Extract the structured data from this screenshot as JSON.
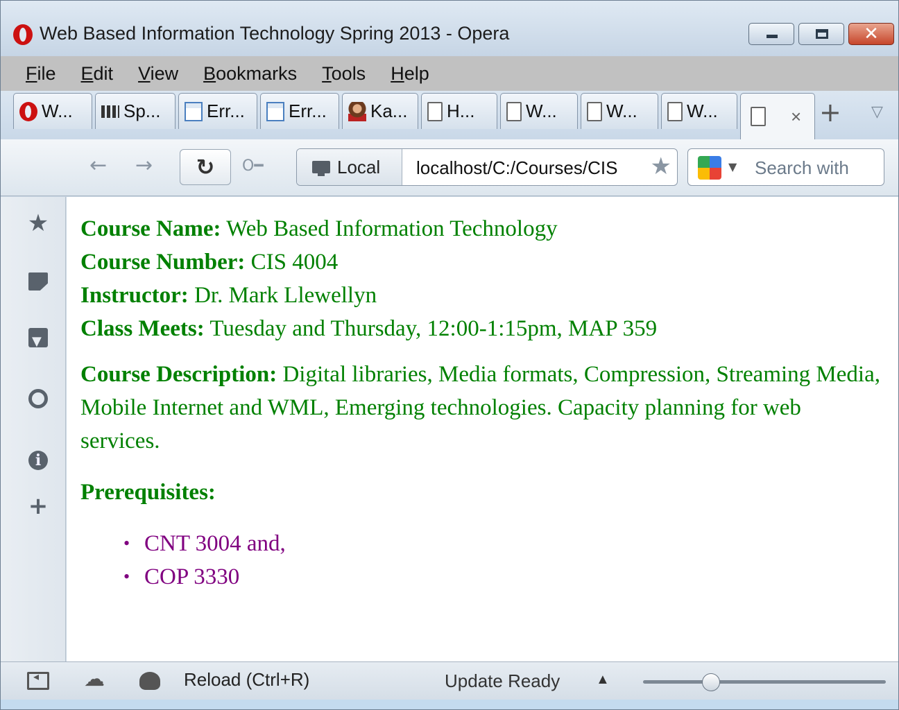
{
  "window": {
    "title": "Web Based Information Technology Spring 2013 - Opera"
  },
  "menu": [
    {
      "label": "File",
      "key": "F",
      "rest": "ile"
    },
    {
      "label": "Edit",
      "key": "E",
      "rest": "dit"
    },
    {
      "label": "View",
      "key": "V",
      "rest": "iew"
    },
    {
      "label": "Bookmarks",
      "key": "B",
      "rest": "ookmarks"
    },
    {
      "label": "Tools",
      "key": "T",
      "rest": "ools"
    },
    {
      "label": "Help",
      "key": "H",
      "rest": "elp"
    }
  ],
  "tabs": [
    {
      "label": "W...",
      "icon": "opera-icon"
    },
    {
      "label": "Sp...",
      "icon": "speed-dial-icon"
    },
    {
      "label": "Err...",
      "icon": "page-error-icon"
    },
    {
      "label": "Err...",
      "icon": "page-error-icon"
    },
    {
      "label": "Ka...",
      "icon": "person-icon"
    },
    {
      "label": "H...",
      "icon": "document-icon"
    },
    {
      "label": "W...",
      "icon": "document-icon"
    },
    {
      "label": "W...",
      "icon": "document-icon"
    },
    {
      "label": "W...",
      "icon": "document-icon"
    },
    {
      "label": "",
      "icon": "document-icon",
      "active": true,
      "close": "×"
    }
  ],
  "tab_add": "+",
  "address": {
    "badge": "Local",
    "url": "localhost/C:/Courses/CIS",
    "search_placeholder": "Search with"
  },
  "page": {
    "course_name_label": "Course Name:",
    "course_name": " Web Based Information Technology",
    "course_number_label": "Course Number:",
    "course_number": " CIS 4004",
    "instructor_label": "Instructor:",
    "instructor": " Dr. Mark Llewellyn",
    "meets_label": "Class Meets:",
    "meets": " Tuesday and Thursday, 12:00-1:15pm, MAP 359",
    "description_label": "Course Description:",
    "description": " Digital libraries, Media formats, Compression, Streaming Media, Mobile Internet and WML, Emerging technologies. Capacity planning for web services.",
    "prerequisites_label": "Prerequisites:",
    "prerequisites": [
      "CNT 3004 and,",
      "COP 3330"
    ]
  },
  "status": {
    "reload_hint": "Reload (Ctrl+R)",
    "update": "Update Ready",
    "zoom_level": 0.28
  },
  "colors": {
    "text_green": "#008000",
    "list_purple": "#800080"
  }
}
